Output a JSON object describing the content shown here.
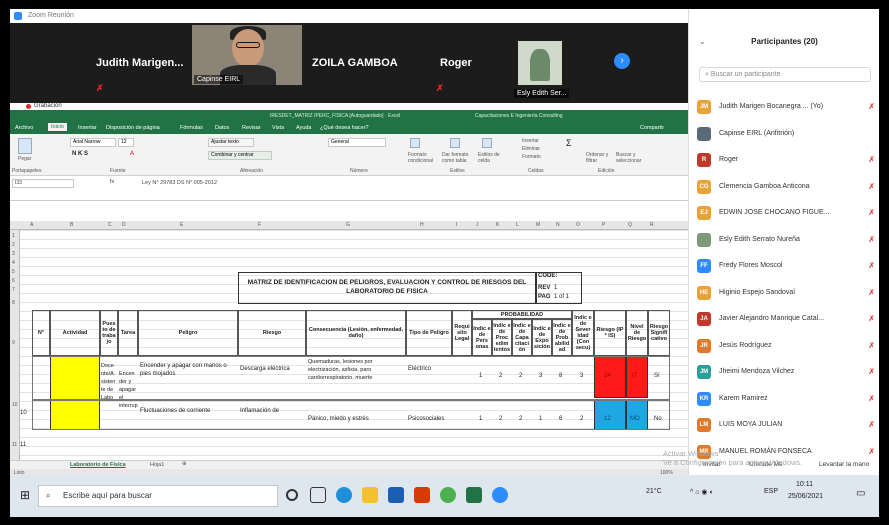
{
  "zoom": {
    "window_title": "Zoom Reunión",
    "participants": [
      {
        "name": "Judith Marigen..."
      },
      {
        "name": "Capinse EIRL"
      },
      {
        "name": "ZOILA GAMBOA"
      },
      {
        "name": "Roger"
      },
      {
        "name": "Esly Edith Ser..."
      }
    ]
  },
  "excel": {
    "recording": "Grabación",
    "title": "IRESDET_MATRIZ IPERC_FISICA [Autoguardado] · Excel",
    "user": "Capacitaciones E Ingeniería Consulting",
    "share": "Compartir",
    "tabs": [
      "Archivo",
      "Inicio",
      "Insertar",
      "Disposición de página",
      "Fórmulas",
      "Datos",
      "Revisar",
      "Vista",
      "Ayuda",
      "¿Qué desea hacer?"
    ],
    "active_tab": "Inicio",
    "ribbon": {
      "paste": "Pegar",
      "clipboard": "Portapapeles",
      "font": "Arial Narrow",
      "font_size": "12",
      "font_group": "Fuente",
      "wrap": "Ajustar texto",
      "merge": "Combinar y centrar",
      "alignment": "Alineación",
      "number_format": "General",
      "number_group": "Número",
      "cond_format": "Formato condicional",
      "table_format": "Dar formato como tabla",
      "cell_styles": "Estilos de celda",
      "styles": "Estilos",
      "insert": "Insertar",
      "delete": "Eliminar",
      "format": "Formato",
      "cells": "Celdas",
      "sort": "Ordenar y filtrar",
      "find": "Buscar y seleccionar",
      "editing": "Edición"
    },
    "name_box": "I33",
    "formula": "Ley N° 29783 DS N° 005-2012",
    "columns": [
      "A",
      "B",
      "C",
      "D",
      "E",
      "F",
      "G",
      "H",
      "I",
      "J",
      "K",
      "L",
      "M",
      "N",
      "O",
      "P",
      "Q",
      "R"
    ],
    "rows": [
      "1",
      "2",
      "3",
      "4",
      "5",
      "6",
      "7",
      "8",
      "9",
      "10",
      "11"
    ],
    "doc_title": "MATRIZ DE IDENTIFICACION DE PELIGROS, EVALUACION Y CONTROL DE RIESGOS DEL LABORATORIO DE FISICA",
    "code_label": "CODE:",
    "rev_label": "REV",
    "rev_value": "1",
    "page_label": "PAG",
    "page_value": "1 of 1",
    "headers": {
      "n": "N°",
      "actividad": "Actividad",
      "puesto": "Pues to de traba jo",
      "tarea": "Tarea",
      "peligro": "Peligro",
      "riesgo": "Riesgo",
      "consecuencia": "Consecuencia (Lesión, enfermedad, daño)",
      "tipo": "Tipo de Peligro",
      "requisito": "Requi sito Legal",
      "probabilidad": "PROBABILIDAD",
      "prob_cols": [
        "Indic e de Pers onas",
        "Indic e de Proc edim ientos",
        "Indic e de Capa citaci ón",
        "Indic e de Expo sición",
        "Indic e de Prob abilid ad"
      ],
      "severidad": "Indic e de Sever idad (Con secu)",
      "riesgo_ps": "Riesgo (IP * IS)",
      "nivel": "Nivel de Riesgo",
      "significativo": "Riesgo Signifi cativo"
    },
    "data_rows": [
      {
        "n": "10",
        "puesto": "Doce nte/A sisten te de Labo",
        "tarea": "Encen der y apagar el interrup",
        "peligro": "Encender y apagar con manos o pies mojados",
        "riesgo": "Descarga eléctrica",
        "consecuencia": "Quemaduras, lesiones por electrización, asfixia, paro cardiorrespiratorio, muerte",
        "tipo": "Eléctrico",
        "vals": [
          "1",
          "2",
          "2",
          "3",
          "8",
          "3"
        ],
        "riesgo_val": "24",
        "nivel": "IT",
        "sig": "Sí"
      },
      {
        "n": "11",
        "tarea": "Fluctuaciones de corriente",
        "riesgo": "Inflamación de",
        "consecuencia": "Pánico, miedo y estrés",
        "tipo": "Psicosociales",
        "vals": [
          "1",
          "2",
          "2",
          "1",
          "6",
          "2"
        ],
        "riesgo_val": "12",
        "nivel": "MO",
        "sig": "No"
      }
    ],
    "sheet_tabs": [
      "Laboratorio de Física",
      "Hoja1"
    ],
    "status": "Listo",
    "zoom_level": "100%"
  },
  "panel": {
    "title": "Participantes (20)",
    "search_placeholder": "Buscar un participante",
    "participants": [
      {
        "initials": "JM",
        "name": "Judith Marigen Bocanegra ... (Yo)",
        "color": "#e8a23a"
      },
      {
        "initials": "",
        "name": "Capinse EIRL (Anfitrión)",
        "color": "#5a6a7a"
      },
      {
        "initials": "R",
        "name": "Roger",
        "color": "#c0392b"
      },
      {
        "initials": "CG",
        "name": "Clemencia Gamboa Anticona",
        "color": "#e8a23a"
      },
      {
        "initials": "EJ",
        "name": "EDWIN JOSE CHOCANO FIGUE...",
        "color": "#e8a23a"
      },
      {
        "initials": "",
        "name": "Esly Edith Serrato Nureña",
        "color": "#7a9a7a"
      },
      {
        "initials": "FF",
        "name": "Fredy Flores Moscol",
        "color": "#2d8cff"
      },
      {
        "initials": "HE",
        "name": "Higinio Espejo Sandoval",
        "color": "#e8a23a"
      },
      {
        "initials": "JA",
        "name": "Javier Alejandro Manrique Catal...",
        "color": "#c0392b"
      },
      {
        "initials": "JR",
        "name": "Jesús Rodríguez",
        "color": "#e07a2a"
      },
      {
        "initials": "JM",
        "name": "Jheimi Mendoza Vilchez",
        "color": "#2aa198"
      },
      {
        "initials": "KR",
        "name": "Karem Ramirez",
        "color": "#2d8cff"
      },
      {
        "initials": "LM",
        "name": "LUIS MOYA JULIAN",
        "color": "#e07a2a"
      },
      {
        "initials": "MR",
        "name": "MANUEL ROMÁN FONSECA",
        "color": "#e07a2a"
      }
    ],
    "invite": "Invitar",
    "unmute": "Unmute Me",
    "raise_hand": "Levantar la mano",
    "watermark_1": "Activar Windows",
    "watermark_2": "Ve a Configuración para activar Windows."
  },
  "taskbar": {
    "search": "Escribe aquí para buscar",
    "temp": "21°C",
    "lang": "ESP",
    "time": "10:11",
    "date": "25/06/2021"
  }
}
